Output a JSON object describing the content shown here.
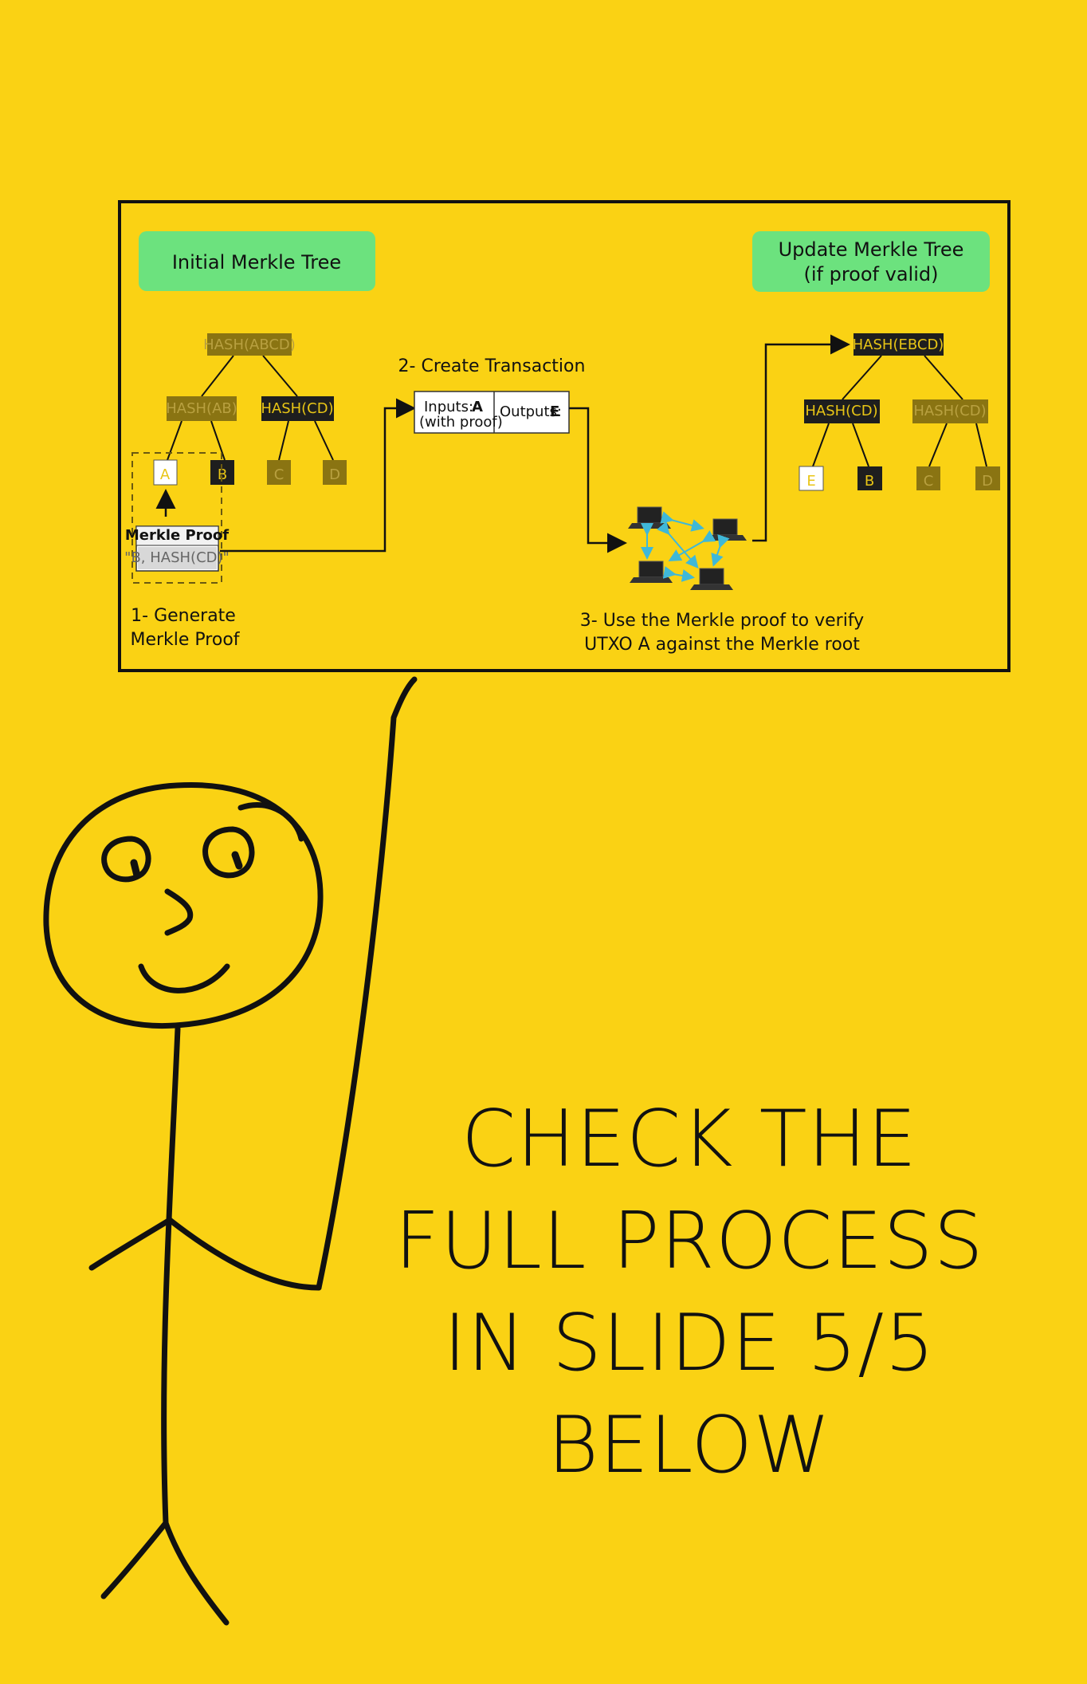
{
  "diagram": {
    "left_pill": "Initial Merkle Tree",
    "right_pill_line1": "Update Merkle Tree",
    "right_pill_line2": "(if proof valid)",
    "initial_tree": {
      "root": "HASH(ABCD)",
      "left": "HASH(AB)",
      "right": "HASH(CD)",
      "leaves": [
        "A",
        "B",
        "C",
        "D"
      ]
    },
    "merkle_proof": {
      "title": "Merkle Proof",
      "value": "\"B, HASH(CD)\""
    },
    "step1_line1": "1- Generate",
    "step1_line2": "Merkle Proof",
    "step2": "2- Create Transaction",
    "transaction": {
      "inputs_label": "Inputs:",
      "inputs_value": "A",
      "inputs_note": "(with proof)",
      "outputs_label": "Outputs:",
      "outputs_value": "E"
    },
    "step3_line1": "3- Use the Merkle proof to verify",
    "step3_line2": "UTXO A against the Merkle root",
    "updated_tree": {
      "root": "HASH(EBCD)",
      "left": "HASH(CD)",
      "right": "HASH(CD)",
      "leaves": [
        "E",
        "B",
        "C",
        "D"
      ]
    }
  },
  "cta": {
    "line1": "CHECK THE",
    "line2": "FULL PROCESS",
    "line3": "IN SLIDE 5/5",
    "line4": "BELOW"
  },
  "colors": {
    "background": "#FAD214",
    "pill": "#6CE27E",
    "dim_node": "#8A7412",
    "dark_node": "#1E1E1E",
    "arrow_blue": "#3FB8D8"
  }
}
